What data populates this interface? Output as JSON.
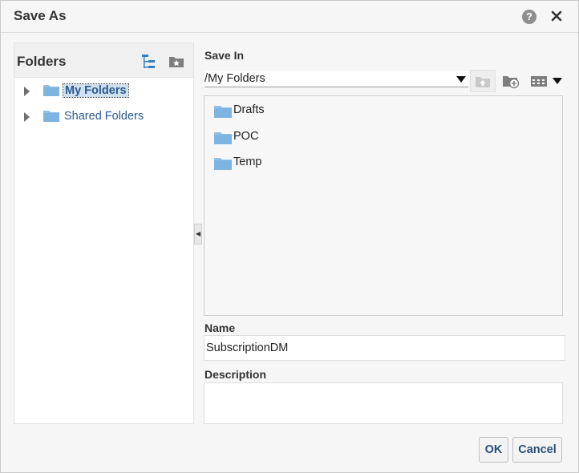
{
  "dialog": {
    "title": "Save As",
    "help_icon": "question-circle-icon",
    "close_icon": "close-icon"
  },
  "folders_panel": {
    "title": "Folders",
    "tree": [
      {
        "label": "My Folders",
        "selected": true
      },
      {
        "label": "Shared Folders",
        "selected": false
      }
    ]
  },
  "save_in": {
    "label": "Save In",
    "path": "/My Folders",
    "items": [
      {
        "label": "Drafts"
      },
      {
        "label": "POC"
      },
      {
        "label": "Temp"
      }
    ]
  },
  "form": {
    "name_label": "Name",
    "name_value": "SubscriptionDM",
    "description_label": "Description",
    "description_value": ""
  },
  "buttons": {
    "ok": "OK",
    "cancel": "Cancel"
  },
  "colors": {
    "folder": "#8fc0e8",
    "link": "#2a5a8a",
    "selected_bg": "#cfe0f1"
  }
}
